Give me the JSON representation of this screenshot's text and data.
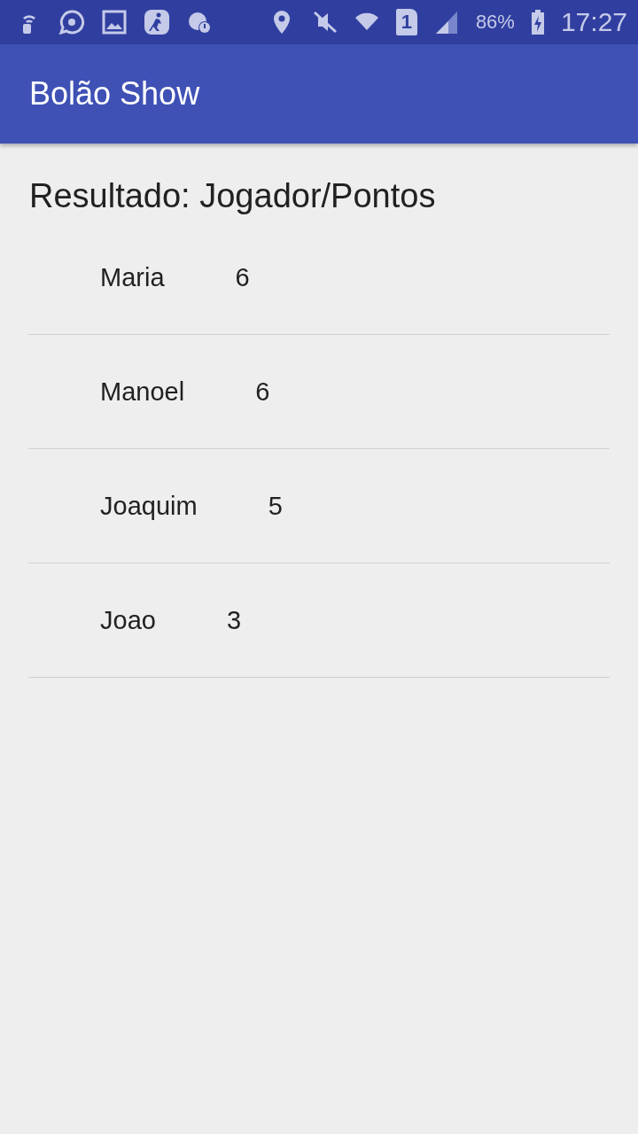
{
  "status_bar": {
    "sim_slot": "1",
    "battery": "86%",
    "time": "17:27"
  },
  "app_bar": {
    "title": "Bolão Show"
  },
  "heading": "Resultado: Jogador/Pontos",
  "results": [
    {
      "player": "Maria",
      "points": "6"
    },
    {
      "player": "Manoel",
      "points": "6"
    },
    {
      "player": "Joaquim",
      "points": "5"
    },
    {
      "player": "Joao",
      "points": "3"
    }
  ]
}
